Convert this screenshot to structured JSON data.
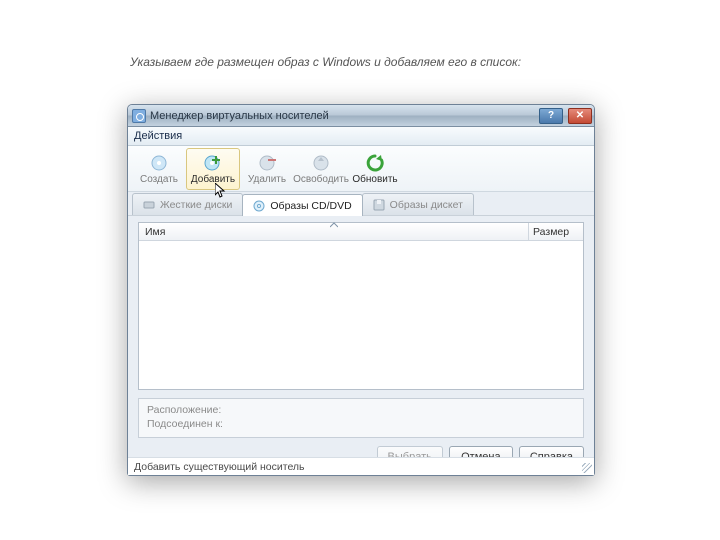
{
  "caption": "Указываем где размещен образ с Windows и добавляем его в список:",
  "window": {
    "title": "Менеджер виртуальных носителей",
    "menubar": {
      "actions": "Действия"
    },
    "toolbar": {
      "create": "Создать",
      "add": "Добавить",
      "remove": "Удалить",
      "release": "Освободить",
      "refresh": "Обновить"
    },
    "tabs": {
      "hdd": "Жесткие диски",
      "cd": "Образы CD/DVD",
      "floppy": "Образы дискет"
    },
    "list": {
      "col_name": "Имя",
      "col_size": "Размер"
    },
    "info": {
      "location_label": "Расположение:",
      "connected_label": "Подсоединен к:"
    },
    "buttons": {
      "choose": "Выбрать",
      "cancel": "Отмена",
      "help": "Справка"
    },
    "status": "Добавить существующий носитель",
    "help_glyph": "?",
    "close_glyph": "✕"
  }
}
